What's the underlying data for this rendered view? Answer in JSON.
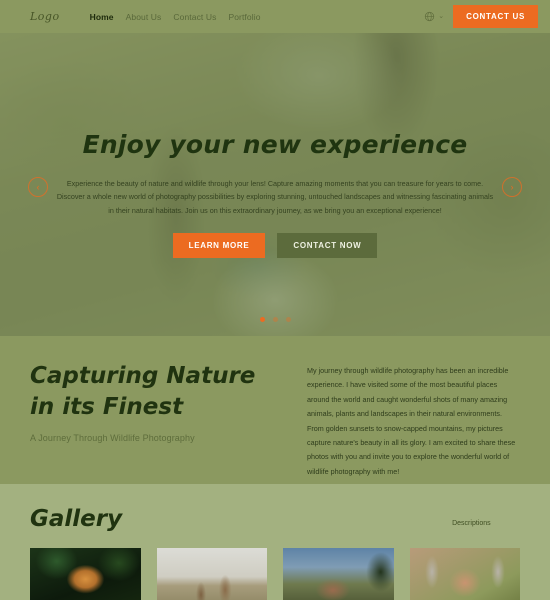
{
  "navbar": {
    "logo": "Logo",
    "links": [
      {
        "label": "Home",
        "active": true
      },
      {
        "label": "About Us",
        "active": false
      },
      {
        "label": "Contact Us",
        "active": false
      },
      {
        "label": "Portfolio",
        "active": false
      }
    ],
    "language_icon": "globe-icon",
    "dropdown_chevron": "⌄",
    "cta_label": "CONTACT US"
  },
  "hero": {
    "title": "Enjoy your new experience",
    "paragraph": "Experience the beauty of nature and wildlife through your lens! Capture amazing moments that you can treasure for years to come. Discover a whole new world of photography possibilities by exploring stunning, untouched landscapes and witnessing fascinating animals in their natural habitats. Join us on this extraordinary journey, as we bring you an exceptional experience!",
    "primary_button": "LEARN MORE",
    "secondary_button": "CONTACT NOW",
    "prev_arrow": "‹",
    "next_arrow": "›",
    "dots": [
      {
        "active": true
      },
      {
        "active": false
      },
      {
        "active": false
      }
    ]
  },
  "about": {
    "title": "Capturing Nature in its Finest",
    "subtitle": "A Journey Through Wildlife Photography",
    "paragraph": "My journey through wildlife photography has been an incredible experience. I have visited some of the most beautiful places around the world and caught wonderful shots of many amazing animals, plants and landscapes in their natural environments. From golden sunsets to snow-capped mountains, my pictures capture nature's beauty in all its glory. I am excited to share these photos with you and invite you to explore the wonderful world of wildlife photography with me!"
  },
  "gallery": {
    "title": "Gallery",
    "descriptions_label": "Descriptions",
    "items": [
      {
        "name": "tiger-photo"
      },
      {
        "name": "giraffes-photo"
      },
      {
        "name": "elephant-photo"
      },
      {
        "name": "deer-antlers-photo"
      }
    ]
  },
  "colors": {
    "accent_orange": "#ec6b21",
    "nav_green": "#8b9960",
    "page_green": "#a3b180",
    "dark_green_text": "#203310"
  }
}
